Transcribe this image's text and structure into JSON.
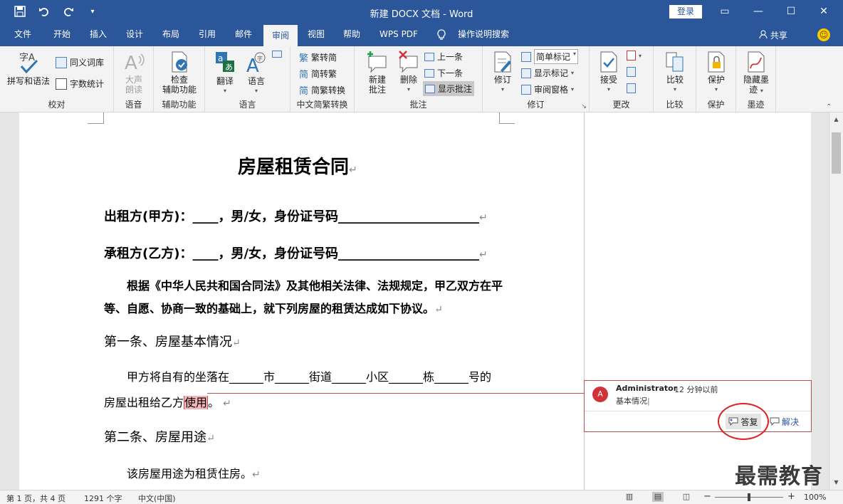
{
  "titlebar": {
    "title": "新建 DOCX 文档  -  Word",
    "login": "登录",
    "qat": {
      "save_icon": "save-icon",
      "undo_icon": "undo-icon",
      "redo_icon": "redo-icon",
      "customize": "▾"
    },
    "win": {
      "ribbon_display": "▭",
      "minimize": "—",
      "maximize": "☐",
      "close": "✕"
    }
  },
  "tabs": [
    {
      "label": "文件"
    },
    {
      "label": "开始"
    },
    {
      "label": "插入"
    },
    {
      "label": "设计"
    },
    {
      "label": "布局"
    },
    {
      "label": "引用"
    },
    {
      "label": "邮件"
    },
    {
      "label": "审阅"
    },
    {
      "label": "视图"
    },
    {
      "label": "帮助"
    },
    {
      "label": "WPS PDF"
    },
    {
      "label": "操作说明搜索"
    }
  ],
  "share": "共享",
  "ribbon": {
    "proofing": {
      "label": "校对",
      "spell": "拼写和语法",
      "thesaurus": "同义词库",
      "wordcount": "字数统计"
    },
    "speech": {
      "label": "语音",
      "read_aloud": "大声\n朗读",
      "read_line1": "大声",
      "read_line2": "朗读"
    },
    "accessibility": {
      "label": "辅助功能",
      "check_line1": "检查",
      "check_line2": "辅助功能"
    },
    "language": {
      "label": "语言",
      "translate": "翻译",
      "language": "语言"
    },
    "chinese": {
      "label": "中文简繁转换",
      "to_trad": "繁转简",
      "to_simp": "简转繁",
      "convert": "简繁转换"
    },
    "comments": {
      "label": "批注",
      "new_line1": "新建",
      "new_line2": "批注",
      "delete": "删除",
      "prev": "上一条",
      "next": "下一条",
      "show": "显示批注"
    },
    "tracking": {
      "label": "修订",
      "track": "修订",
      "markup_select": "简单标记",
      "show_markup": "显示标记",
      "review_pane": "审阅窗格"
    },
    "changes": {
      "label": "更改",
      "accept": "接受"
    },
    "compare": {
      "label": "比较",
      "compare": "比较"
    },
    "protect": {
      "label": "保护",
      "protect": "保护"
    },
    "ink": {
      "label": "墨迹",
      "hide_line1": "隐藏墨",
      "hide_line2": "迹"
    }
  },
  "document": {
    "title": "房屋租赁合同",
    "lessor": "出租方(甲方)：____，男/女，身份证号码______________________",
    "lessee": "承租方(乙方)：____，男/女，身份证号码______________________",
    "intro_line1": "根据《中华人民共和国合同法》及其他相关法律、法规规定，甲乙双方在平",
    "intro_line2": "等、自愿、协商一致的基础上，就下列房屋的租赁达成如下协议。",
    "sec1": "第一条、房屋基本情况",
    "sec1_line1": "甲方将自有的坐落在______市______街道______小区______栋______号的",
    "sec1_line2_a": "房屋出租给乙方",
    "sec1_line2_hl": "使用",
    "sec1_line2_b": "。",
    "sec2": "第二条、房屋用途",
    "sec2_line1": "该房屋用途为租赁住房。",
    "para_mark": "↵"
  },
  "comment": {
    "avatar": "A",
    "author": "Administrator",
    "time": "12 分钟以前",
    "text": "基本情况",
    "reply": "答复",
    "resolve": "解决"
  },
  "statusbar": {
    "page": "第 1 页，共 4 页",
    "words": "1291 个字",
    "lang": "中文(中国)",
    "zoom_minus": "−",
    "zoom_plus": "+",
    "zoom": "100%",
    "zoom_level": 1.0
  },
  "watermark": "最需教育",
  "colors": {
    "brand": "#2b579a",
    "comment_border": "#c0504d",
    "highlight": "#f4b6b6",
    "annotation_circle": "#e02020"
  }
}
